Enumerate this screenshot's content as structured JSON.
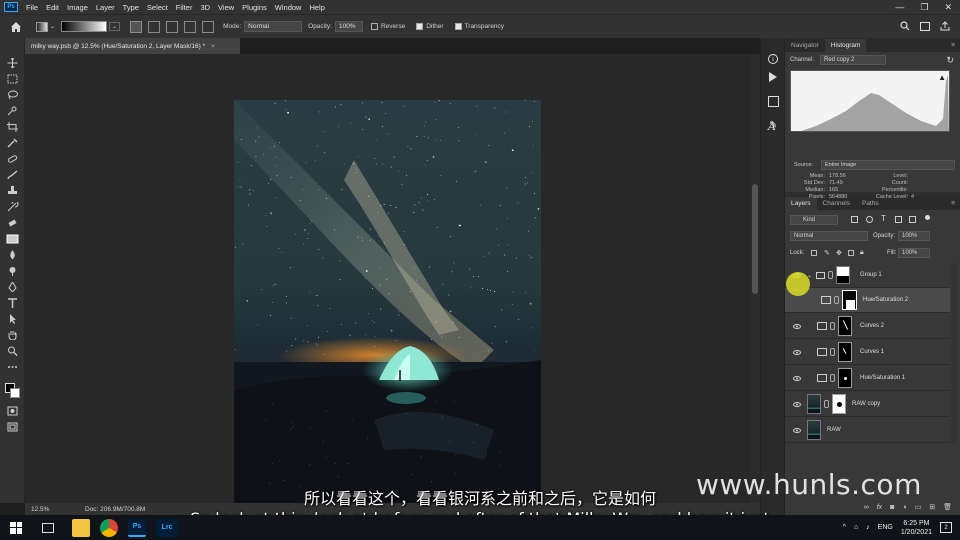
{
  "menubar": {
    "items": [
      "File",
      "Edit",
      "Image",
      "Layer",
      "Type",
      "Select",
      "Filter",
      "3D",
      "View",
      "Plugins",
      "Window",
      "Help"
    ],
    "ps_logo": "Ps"
  },
  "options": {
    "mode_label": "Mode:",
    "mode_value": "Normal",
    "opacity_label": "Opacity:",
    "opacity_value": "100%",
    "reverse_label": "Reverse",
    "dither_label": "Dither",
    "transparency_label": "Transparency",
    "reverse_checked": false,
    "dither_checked": true,
    "transparency_checked": true
  },
  "document": {
    "tab_title": "milky way.psb @ 12.5% (Hue/Saturation 2, Layer Mask/16) *",
    "close": "×"
  },
  "status": {
    "zoom": "12.5%",
    "doc_info": "Doc: 206.9M/700.8M"
  },
  "histogram": {
    "tabs": [
      "Navigator",
      "Histogram"
    ],
    "active_tab": "Histogram",
    "channel_label": "Channel:",
    "channel_value": "Red copy 2",
    "source_label": "Source:",
    "source_value": "Entire Image",
    "stats_left": [
      {
        "label": "Mean:",
        "value": "178.56"
      },
      {
        "label": "Std Dev:",
        "value": "71.49"
      },
      {
        "label": "Median:",
        "value": "165"
      },
      {
        "label": "Pixels:",
        "value": "564880"
      }
    ],
    "stats_right": [
      {
        "label": "Level:",
        "value": ""
      },
      {
        "label": "Count:",
        "value": ""
      },
      {
        "label": "Percentile:",
        "value": ""
      },
      {
        "label": "Cache Level:",
        "value": "4"
      }
    ]
  },
  "layers_panel": {
    "tabs": [
      "Layers",
      "Channels",
      "Paths"
    ],
    "active_tab": "Layers",
    "filter_label": "Kind",
    "blend_mode": "Normal",
    "opacity_label": "Opacity:",
    "opacity_value": "100%",
    "lock_label": "Lock:",
    "fill_label": "Fill:",
    "fill_value": "100%",
    "layers": [
      {
        "name": "Group 1",
        "type": "group"
      },
      {
        "name": "Hue/Saturation 2",
        "type": "adjustment",
        "selected": true
      },
      {
        "name": "Curves 2",
        "type": "curves"
      },
      {
        "name": "Curves 1",
        "type": "curves"
      },
      {
        "name": "Hue/Saturation 1",
        "type": "adjustment"
      },
      {
        "name": "RAW copy",
        "type": "pixel"
      },
      {
        "name": "RAW",
        "type": "pixel"
      }
    ],
    "footer_icons": [
      "link-icon",
      "fx-icon",
      "mask-icon",
      "adjustment-icon",
      "folder-icon",
      "new-layer-icon",
      "trash-icon"
    ]
  },
  "overlay": {
    "subtitle_cn": "所以看看这个，看看银河系之前和之后，它是如何",
    "subtitle_en": "So look at this, look at before and after of that Milky Way and how it just",
    "watermark": "www.hunls.com"
  },
  "taskbar": {
    "time": "6:25 PM",
    "date": "1/20/2021",
    "lang": "ENG",
    "apps": [
      "start",
      "task-view",
      "file-explorer",
      "chrome",
      "photoshop",
      "lightroom"
    ],
    "lrc_label": "Lrc",
    "ps_label": "Ps",
    "notif_count": "2"
  },
  "colors": {
    "accent_ps": "#31a8ff",
    "panel_bg": "#2e2e2e",
    "selected_layer": "#4a4a4a"
  }
}
